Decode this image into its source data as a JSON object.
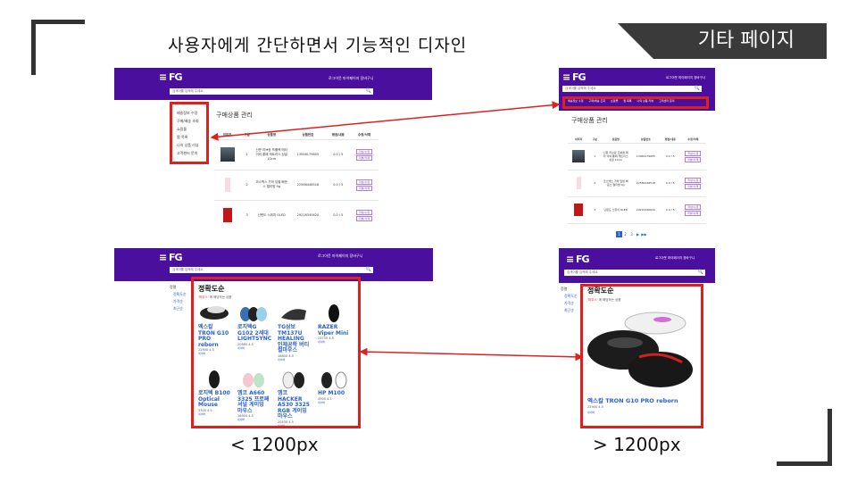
{
  "slide": {
    "subtitle": "사용자에게 간단하면서 기능적인 디자인",
    "tag": "기타 페이지",
    "label_left": "< 1200px",
    "label_right": "> 1200px"
  },
  "header": {
    "logo": "≡ FG",
    "links": "로그아웃   마이페이지   장바구니",
    "search_placeholder": "검색어를 입력해 주세요",
    "search_btn": "🔍"
  },
  "manage": {
    "side_items": [
      "배송정보 수정",
      "구매/배송 조회",
      "쇼핑몰",
      "찜 목록",
      "나의 상품 리뷰",
      "고객센터 문의"
    ],
    "title": "구매상품 관리",
    "columns": [
      "이미지",
      "구분",
      "상품명",
      "상품번호",
      "평점/내용",
      "수정/삭제"
    ],
    "rows": [
      {
        "no": "1",
        "name": "신문 리브랑 프롤렉 메타 이외 롱패 캐트리스 싱글 10cm",
        "code": "13946179605",
        "score": "0.0 / 5",
        "b1": "작성/수정",
        "b2": "리뷰/삭제"
      },
      {
        "no": "2",
        "name": "코스맥스 가하 임팔 빠운스 멀티밤 9g",
        "code": "22566448518",
        "score": "0.0 / 5",
        "b1": "작성/수정",
        "b2": "리뷰/삭제"
      },
      {
        "no": "3",
        "name": "닌텐도 스위치 OLED",
        "code": "29216340620",
        "score": "0.0 / 5",
        "b1": "작성/수정",
        "b2": "리뷰/삭제"
      }
    ],
    "pages": [
      "1",
      "2",
      "3",
      "▶",
      "▶▶"
    ]
  },
  "search": {
    "title": "정확도순",
    "note_keyword": "'마우스'",
    "note_rest": " 에 해당하는 상품",
    "cats_title": "정렬",
    "cats": [
      "정확도순",
      "가격순",
      "최근순"
    ],
    "products": [
      {
        "name": "엑스칼 TRON G10 PRO reborn",
        "price": "22900   4.5",
        "shop": "네이버"
      },
      {
        "name": "로지텍G G102 2세대 LIGHTSYNC",
        "price": "20580   4.5",
        "shop": "네이버"
      },
      {
        "name": "TG삼보 TM137U HEALING 인체공학 버티컬마우스",
        "price": "18800   4.5",
        "shop": "네이버"
      },
      {
        "name": "RAZER Viper Mini",
        "price": "23730   4.5",
        "shop": "네이버"
      },
      {
        "name": "로지텍 B100 Optical Mouse",
        "price": "3300   4.5",
        "shop": "네이버"
      },
      {
        "name": "엠코 A660 3325 프로페셔널 게이밍 마우스",
        "price": "16900   4.5",
        "shop": "네이버"
      },
      {
        "name": "엠코 HACKER A530 3325 RGB 게이밍 마우스",
        "price": "20430   4.5",
        "shop": "네이버"
      },
      {
        "name": "HP M100",
        "price": "4900   4.5",
        "shop": "네이버"
      }
    ],
    "big_product": {
      "name": "엑스칼 TRON G10 PRO reborn",
      "price": "22900   4.5",
      "shop": "네이버"
    }
  },
  "colors": {
    "header": "#4b0f9e",
    "highlight": "#e0201c",
    "link": "#2a60d0"
  }
}
